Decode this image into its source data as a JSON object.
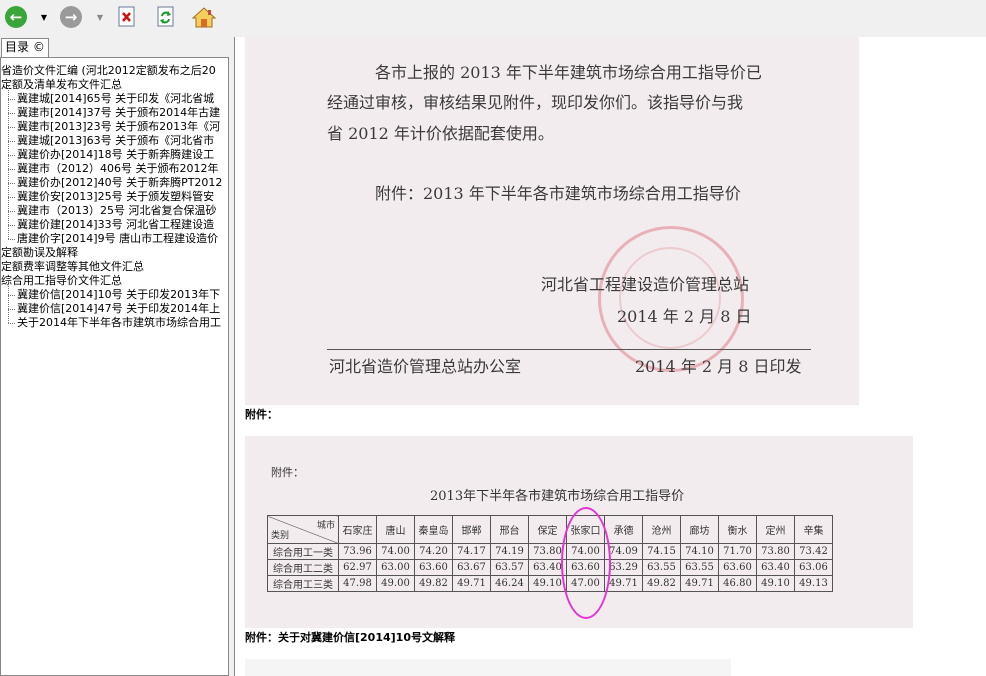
{
  "sidebar": {
    "tab_label": "目录 ©",
    "tree": [
      {
        "label": "省造价文件汇编 (河北2012定额发布之后20",
        "child": false
      },
      {
        "label": "定额及清单发布文件汇总",
        "child": false
      },
      {
        "label": "冀建城[2014]65号 关于印发《河北省城",
        "child": true
      },
      {
        "label": "冀建市[2014]37号 关于颁布2014年古建",
        "child": true
      },
      {
        "label": "冀建市[2013]23号 关于颁布2013年《河",
        "child": true
      },
      {
        "label": "冀建城[2013]63号 关于颁布《河北省市",
        "child": true
      },
      {
        "label": "冀建价办[2014]18号 关于新奔腾建设工",
        "child": true
      },
      {
        "label": "冀建市（2012）406号 关于颁布2012年",
        "child": true
      },
      {
        "label": "冀建价办[2012]40号 关于新奔腾PT2012",
        "child": true
      },
      {
        "label": "冀建价安[2013]25号 关于颁发塑料管安",
        "child": true
      },
      {
        "label": "冀建市（2013）25号 河北省复合保温砂",
        "child": true
      },
      {
        "label": "冀建价建[2014]33号 河北省工程建设造",
        "child": true
      },
      {
        "label": "唐建价字[2014]9号 唐山市工程建设造价",
        "child": true
      },
      {
        "label": "定额勘误及解释",
        "child": false
      },
      {
        "label": "定额费率调整等其他文件汇总",
        "child": false
      },
      {
        "label": "综合用工指导价文件汇总",
        "child": false
      },
      {
        "label": "冀建价信[2014]10号 关于印发2013年下",
        "child": true
      },
      {
        "label": "冀建价信[2014]47号 关于印发2014年上",
        "child": true
      },
      {
        "label": "关于2014年下半年各市建筑市场综合用工",
        "child": true
      }
    ]
  },
  "document": {
    "line1": "各市上报的 2013 年下半年建筑市场综合用工指导价已",
    "line2": "经通过审核，审核结果见附件，现印发你们。该指导价与我",
    "line3": "省 2012 年计价依据配套使用。",
    "attachment_line": "附件：2013 年下半年各市建筑市场综合用工指导价",
    "issuer": "河北省工程建设造价管理总站",
    "sign_date": "2014 年 2 月 8 日",
    "office": "河北省造价管理总站办公室",
    "print_date": "2014 年 2 月 8 日印发"
  },
  "caption_attachment": "附件：",
  "table_doc": {
    "label": "附件：",
    "title": "2013年下半年各市建筑市场综合用工指导价",
    "corner_top": "城市",
    "corner_bottom": "类别",
    "cities": [
      "石家庄",
      "唐山",
      "秦皇岛",
      "邯郸",
      "邢台",
      "保定",
      "张家口",
      "承德",
      "沧州",
      "廊坊",
      "衡水",
      "定州",
      "辛集"
    ],
    "rows": [
      {
        "label": "综合用工一类",
        "values": [
          "73.96",
          "74.00",
          "74.20",
          "74.17",
          "74.19",
          "73.80",
          "74.00",
          "74.09",
          "74.15",
          "74.10",
          "71.70",
          "73.80",
          "73.42"
        ]
      },
      {
        "label": "综合用工二类",
        "values": [
          "62.97",
          "63.00",
          "63.60",
          "63.67",
          "63.57",
          "63.40",
          "63.60",
          "63.29",
          "63.55",
          "63.55",
          "63.60",
          "63.40",
          "63.06"
        ]
      },
      {
        "label": "综合用工三类",
        "values": [
          "47.98",
          "49.00",
          "49.82",
          "49.71",
          "46.24",
          "49.10",
          "47.00",
          "49.71",
          "49.82",
          "49.71",
          "46.80",
          "49.10",
          "49.13"
        ]
      }
    ]
  },
  "caption_explain": "附件：关于对冀建价信[2014]10号文解释"
}
